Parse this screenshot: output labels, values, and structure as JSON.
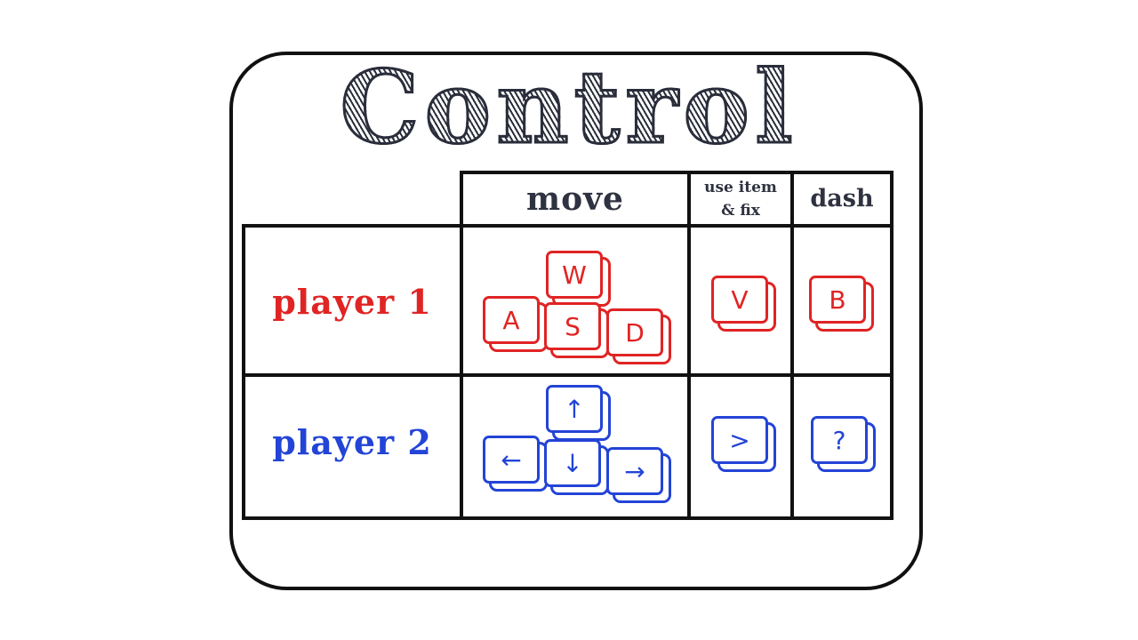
{
  "title": "Control",
  "columns": {
    "move": "move",
    "use_item_line1": "use item",
    "use_item_line2": "& fix",
    "dash": "dash"
  },
  "players": [
    {
      "label": "player 1",
      "color": "#e02424",
      "move_keys": {
        "up": "W",
        "left": "A",
        "down": "S",
        "right": "D"
      },
      "use_item_key": "V",
      "dash_key": "B"
    },
    {
      "label": "player 2",
      "color": "#2344d6",
      "move_keys": {
        "up": "↑",
        "left": "←",
        "down": "↓",
        "right": "→"
      },
      "use_item_key": ">",
      "dash_key": "?"
    }
  ]
}
